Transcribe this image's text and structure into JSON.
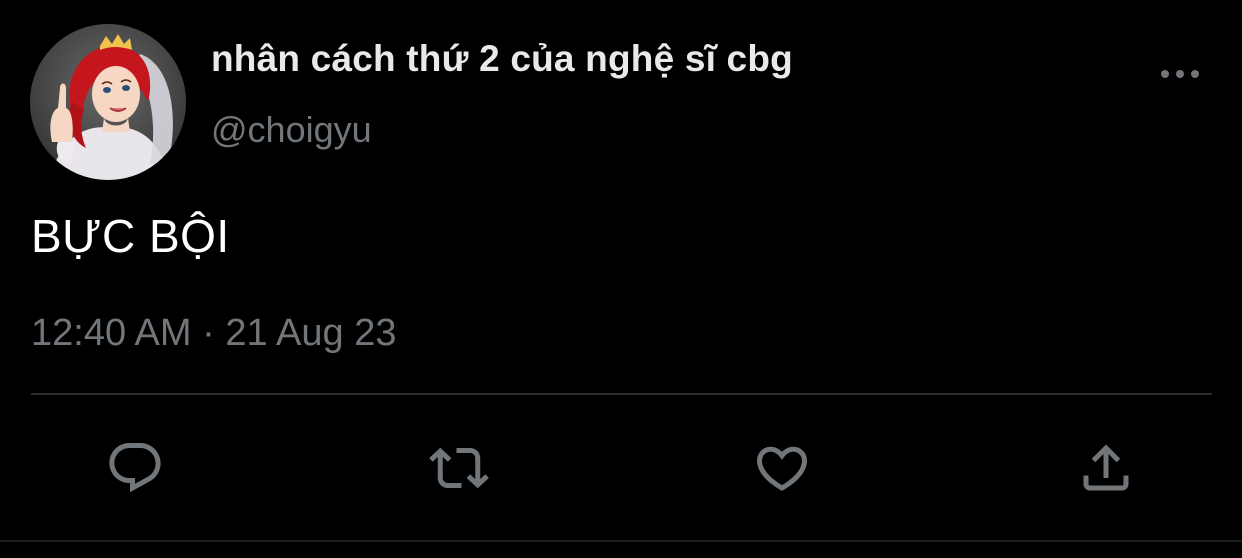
{
  "tweet": {
    "author": {
      "display_name": "nhân cách thứ 2 của nghệ sĩ cbg",
      "handle": "@choigyu",
      "avatar_icon": "cartoon-avatar"
    },
    "text": "BỰC BỘI",
    "timestamp": "12:40 AM · 21 Aug 23",
    "actions": {
      "reply_icon": "reply-icon",
      "retweet_icon": "retweet-icon",
      "like_icon": "heart-icon",
      "share_icon": "share-icon"
    },
    "more_icon": "more-icon"
  },
  "colors": {
    "background": "#000000",
    "primary_text": "#e7e9ea",
    "secondary_text": "#71767b",
    "divider": "#2a2d31"
  }
}
